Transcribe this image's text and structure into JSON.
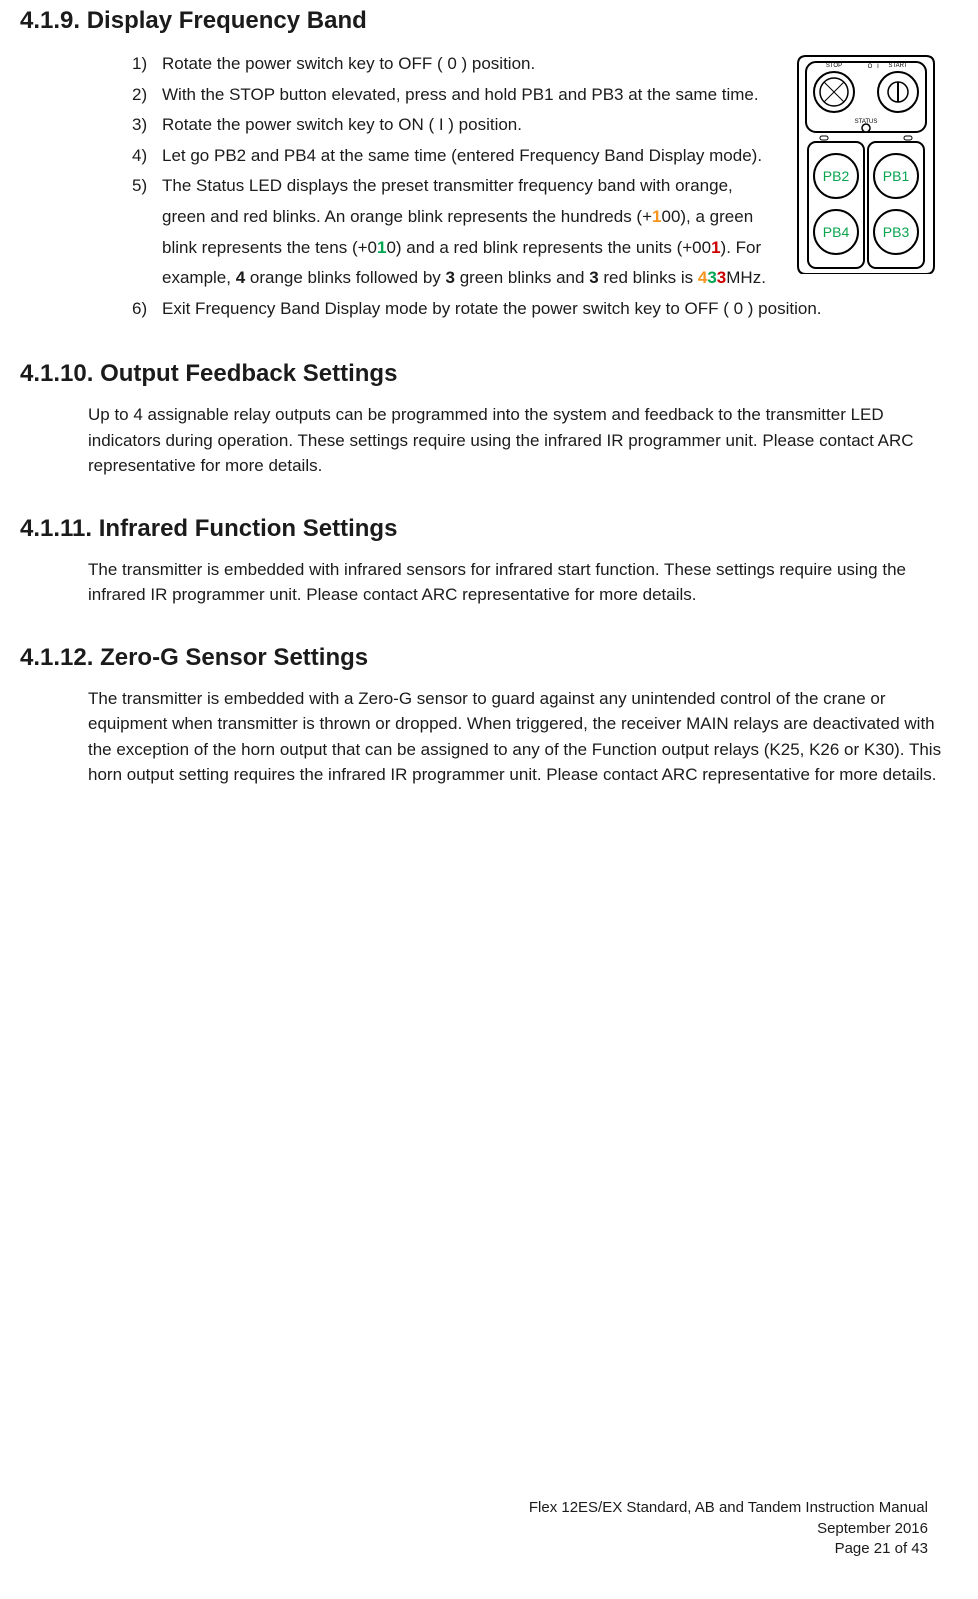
{
  "sections": {
    "s419": {
      "heading": "4.1.9. Display Frequency Band",
      "steps": [
        {
          "n": "1)",
          "parts": [
            {
              "t": "Rotate the power switch key to OFF ( 0 ) position."
            }
          ]
        },
        {
          "n": "2)",
          "parts": [
            {
              "t": "With the STOP button elevated, press and hold PB1 and PB3 at the same time."
            }
          ]
        },
        {
          "n": "3)",
          "parts": [
            {
              "t": "Rotate the power switch key to ON ( I ) position."
            }
          ]
        },
        {
          "n": "4)",
          "parts": [
            {
              "t": "Let go PB2 and PB4 at the same time (entered Frequency Band Display mode)."
            }
          ]
        },
        {
          "n": "5)",
          "parts": [
            {
              "t": "The Status LED displays the preset transmitter frequency band with orange, green and red blinks.  An orange blink represents the hundreds (+"
            },
            {
              "t": "1",
              "cls": "orange"
            },
            {
              "t": "00), a green blink represents the tens (+0"
            },
            {
              "t": "1",
              "cls": "green"
            },
            {
              "t": "0) and a red blink represents the units (+00"
            },
            {
              "t": "1",
              "cls": "red"
            },
            {
              "t": ").  For example, "
            },
            {
              "t": "4",
              "cls": "bold"
            },
            {
              "t": " orange blinks followed by "
            },
            {
              "t": "3",
              "cls": "bold"
            },
            {
              "t": " green blinks and "
            },
            {
              "t": "3",
              "cls": "bold"
            },
            {
              "t": " red blinks is "
            },
            {
              "t": "4",
              "cls": "orange"
            },
            {
              "t": "3",
              "cls": "green"
            },
            {
              "t": "3",
              "cls": "red"
            },
            {
              "t": "MHz."
            }
          ]
        },
        {
          "n": "6)",
          "parts": [
            {
              "t": "Exit Frequency Band Display mode by rotate the power switch key to OFF ( 0 ) position."
            }
          ]
        }
      ]
    },
    "s4110": {
      "heading": "4.1.10.    Output Feedback Settings",
      "body": "Up to 4 assignable relay outputs can be programmed into the system and feedback to the transmitter LED indicators during operation.  These settings require using the infrared IR programmer unit.  Please contact ARC representative for more details."
    },
    "s4111": {
      "heading": "4.1.11.    Infrared Function Settings",
      "body": "The transmitter is embedded with infrared sensors for infrared start function.  These settings require using the infrared IR programmer unit.  Please contact ARC representative for more details."
    },
    "s4112": {
      "heading": "4.1.12.    Zero-G Sensor Settings",
      "body": "The transmitter is embedded with a Zero-G sensor to guard against any unintended control of the crane or equipment when transmitter is thrown or dropped.  When triggered, the receiver MAIN relays are deactivated with the exception of the horn output that can be assigned to any of the Function output relays (K25, K26 or K30).  This horn output setting requires the infrared IR programmer unit.  Please contact ARC representative for more details."
    }
  },
  "diagram": {
    "pb2": "PB2",
    "pb1": "PB1",
    "pb4": "PB4",
    "pb3": "PB3",
    "status": "STATUS",
    "stop": "STOP",
    "start": "START"
  },
  "footer": {
    "line1": "Flex 12ES/EX Standard, AB and Tandem Instruction Manual",
    "line2": "September 2016",
    "line3": "Page 21 of 43"
  }
}
